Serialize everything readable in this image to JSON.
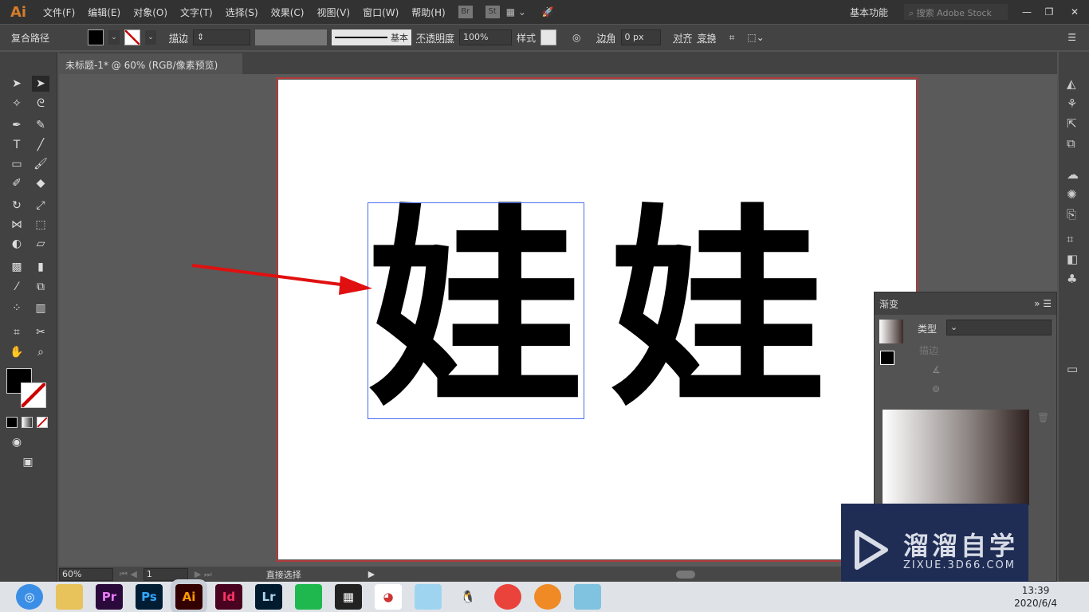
{
  "app": {
    "logo": "Ai",
    "menus": [
      "文件(F)",
      "编辑(E)",
      "对象(O)",
      "文字(T)",
      "选择(S)",
      "效果(C)",
      "视图(V)",
      "窗口(W)",
      "帮助(H)"
    ],
    "bridge": "Br",
    "stock": "St",
    "workspace": "基本功能",
    "search_placeholder": "搜索 Adobe Stock"
  },
  "control": {
    "object_type": "复合路径",
    "stroke_label": "描边",
    "stroke_style": "基本",
    "opacity_label": "不透明度",
    "opacity": "100%",
    "style_label": "样式",
    "corner_label": "边角",
    "corner_value": "0 px",
    "align": "对齐",
    "transform": "变换"
  },
  "document": {
    "tab": "未标题-1* @ 60% (RGB/像素预览)",
    "close": "×"
  },
  "artwork": {
    "text": [
      "娃",
      "娃"
    ]
  },
  "status": {
    "zoom": "60%",
    "page": "1",
    "tool": "直接选择"
  },
  "gradient_panel": {
    "title": "渐变",
    "type_label": "类型",
    "stroke_label": "描边"
  },
  "taskbar": {
    "apps": [
      {
        "name": "Pr",
        "color": "#2a0a3a",
        "fg": "#e77cf6"
      },
      {
        "name": "Ps",
        "color": "#001d34",
        "fg": "#31a8ff"
      },
      {
        "name": "Ai",
        "color": "#330000",
        "fg": "#ff9a00"
      },
      {
        "name": "Id",
        "color": "#49021f",
        "fg": "#ff3366"
      },
      {
        "name": "Lr",
        "color": "#001a2e",
        "fg": "#add5ec"
      }
    ],
    "time": "13:39",
    "date": "2020/6/4"
  },
  "watermark": {
    "title": "溜溜自学",
    "url": "ZIXUE.3D66.COM"
  },
  "colors": {
    "arrow": "#e01010",
    "selection": "#4a6cf0",
    "artboard_border": "#b23a3a"
  }
}
